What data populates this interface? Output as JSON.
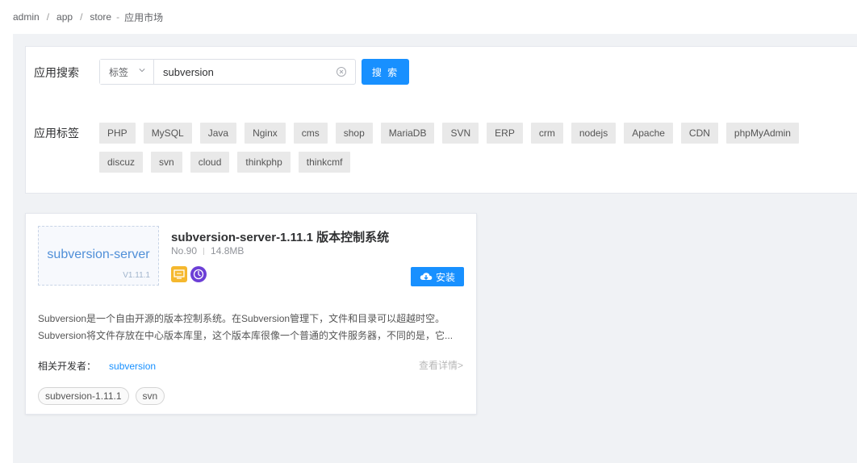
{
  "breadcrumb": {
    "items": [
      "admin",
      "app",
      "store"
    ],
    "separator": "/",
    "dash": "-",
    "current": "应用市场"
  },
  "search": {
    "label": "应用搜索",
    "select_value": "标签",
    "input_value": "subversion",
    "button_label": "搜 索"
  },
  "tags": {
    "label": "应用标签",
    "items": [
      "PHP",
      "MySQL",
      "Java",
      "Nginx",
      "cms",
      "shop",
      "MariaDB",
      "SVN",
      "ERP",
      "crm",
      "nodejs",
      "Apache",
      "CDN",
      "phpMyAdmin",
      "discuz",
      "svn",
      "cloud",
      "thinkphp",
      "thinkcmf"
    ]
  },
  "card": {
    "logo_name": "subversion-server",
    "logo_version": "V1.11.1",
    "title": "subversion-server-1.11.1 版本控制系统",
    "number": "No.90",
    "size": "14.8MB",
    "install_label": "安装",
    "description": [
      "Subversion是一个自由开源的版本控制系统。在Subversion管理下，文件和目录可以超越时空。",
      "Subversion将文件存放在中心版本库里，这个版本库很像一个普通的文件服务器，不同的是，它..."
    ],
    "developer_label": "相关开发者：",
    "developer": "subversion",
    "details_label": "查看详情>",
    "tags": [
      "subversion-1.11.1",
      "svn"
    ]
  },
  "colors": {
    "primary": "#1890ff",
    "badge_yellow": "#f5b82e",
    "badge_purple": "#6c3fd6",
    "page_bg": "#f0f2f5"
  }
}
